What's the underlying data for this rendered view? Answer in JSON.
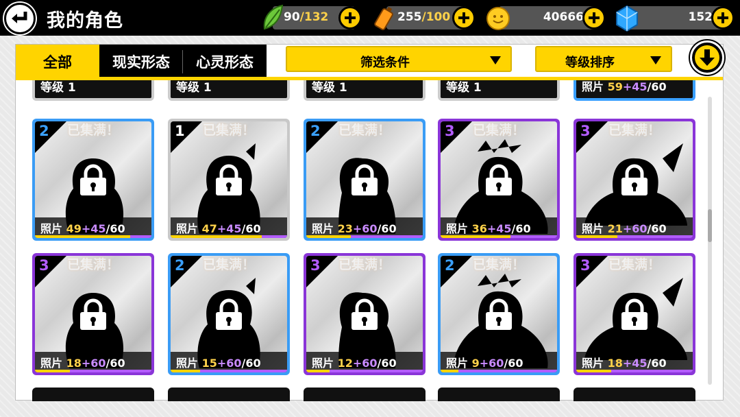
{
  "header": {
    "title": "我的角色",
    "stamina": {
      "current": "90",
      "max": "/132"
    },
    "energy": {
      "current": "255",
      "max": "/100"
    },
    "coins": "40666",
    "gems": "152"
  },
  "tabs": [
    {
      "label": "全部",
      "active": true
    },
    {
      "label": "现实形态",
      "active": false
    },
    {
      "label": "心灵形态",
      "active": false
    }
  ],
  "filter": {
    "label": "筛选条件"
  },
  "sort": {
    "label": "等级排序"
  },
  "partial_row": [
    {
      "level_text": "等级 1"
    },
    {
      "level_text": "等级 1"
    },
    {
      "level_text": "等级 1"
    },
    {
      "level_text": "等级 1"
    },
    {
      "photo_label": "照片",
      "owned": "59",
      "plus": "+45",
      "total": "/60"
    }
  ],
  "cards": [
    {
      "rarity": "2",
      "rarity_color": "blue",
      "full_label": "已集满！",
      "photo_label": "照片",
      "owned": "49",
      "plus": "+45",
      "total": "/60"
    },
    {
      "rarity": "1",
      "rarity_color": "grey",
      "full_label": "已集满！",
      "photo_label": "照片",
      "owned": "47",
      "plus": "+45",
      "total": "/60"
    },
    {
      "rarity": "2",
      "rarity_color": "blue",
      "full_label": "已集满！",
      "photo_label": "照片",
      "owned": "23",
      "plus": "+60",
      "total": "/60"
    },
    {
      "rarity": "3",
      "rarity_color": "purple",
      "full_label": "已集满！",
      "photo_label": "照片",
      "owned": "36",
      "plus": "+45",
      "total": "/60"
    },
    {
      "rarity": "3",
      "rarity_color": "purple",
      "full_label": "已集满！",
      "photo_label": "照片",
      "owned": "21",
      "plus": "+60",
      "total": "/60"
    },
    {
      "rarity": "3",
      "rarity_color": "purple",
      "full_label": "已集满！",
      "photo_label": "照片",
      "owned": "18",
      "plus": "+60",
      "total": "/60"
    },
    {
      "rarity": "2",
      "rarity_color": "blue",
      "full_label": "已集满！",
      "photo_label": "照片",
      "owned": "15",
      "plus": "+60",
      "total": "/60"
    },
    {
      "rarity": "3",
      "rarity_color": "purple",
      "full_label": "已集满！",
      "photo_label": "照片",
      "owned": "12",
      "plus": "+60",
      "total": "/60"
    },
    {
      "rarity": "2",
      "rarity_color": "blue",
      "full_label": "已集满！",
      "photo_label": "照片",
      "owned": "9",
      "plus": "+60",
      "total": "/60"
    },
    {
      "rarity": "3",
      "rarity_color": "purple",
      "full_label": "已集满！",
      "photo_label": "照片",
      "owned": "18",
      "plus": "+45",
      "total": "/60"
    }
  ],
  "colors": {
    "accent": "#ffd400",
    "rarity_blue": "#3a9cf5",
    "rarity_purple": "#8a35d8",
    "rarity_grey": "#c8c8c8"
  }
}
